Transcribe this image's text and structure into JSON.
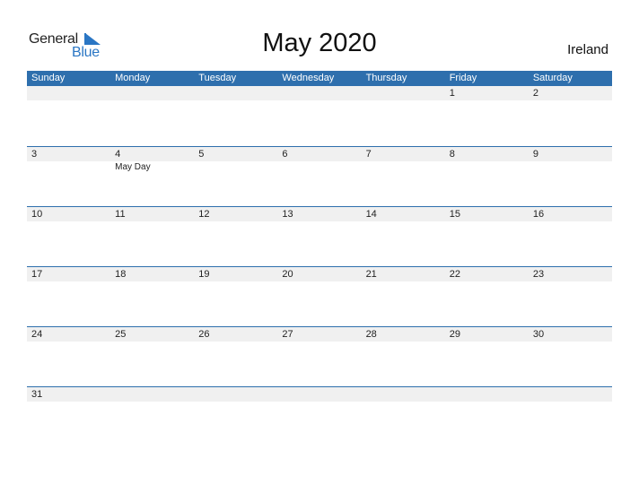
{
  "logo": {
    "text_general": "General",
    "text_blue": "Blue",
    "icon": "triangle-flag-icon",
    "brand_color": "#2a76c4"
  },
  "title": "May 2020",
  "country": "Ireland",
  "colors": {
    "header_bg": "#2e6fad",
    "date_strip_bg": "#f0f0f0"
  },
  "weekdays": [
    "Sunday",
    "Monday",
    "Tuesday",
    "Wednesday",
    "Thursday",
    "Friday",
    "Saturday"
  ],
  "weeks": [
    [
      {
        "day": "",
        "holiday": ""
      },
      {
        "day": "",
        "holiday": ""
      },
      {
        "day": "",
        "holiday": ""
      },
      {
        "day": "",
        "holiday": ""
      },
      {
        "day": "",
        "holiday": ""
      },
      {
        "day": "1",
        "holiday": ""
      },
      {
        "day": "2",
        "holiday": ""
      }
    ],
    [
      {
        "day": "3",
        "holiday": ""
      },
      {
        "day": "4",
        "holiday": "May Day"
      },
      {
        "day": "5",
        "holiday": ""
      },
      {
        "day": "6",
        "holiday": ""
      },
      {
        "day": "7",
        "holiday": ""
      },
      {
        "day": "8",
        "holiday": ""
      },
      {
        "day": "9",
        "holiday": ""
      }
    ],
    [
      {
        "day": "10",
        "holiday": ""
      },
      {
        "day": "11",
        "holiday": ""
      },
      {
        "day": "12",
        "holiday": ""
      },
      {
        "day": "13",
        "holiday": ""
      },
      {
        "day": "14",
        "holiday": ""
      },
      {
        "day": "15",
        "holiday": ""
      },
      {
        "day": "16",
        "holiday": ""
      }
    ],
    [
      {
        "day": "17",
        "holiday": ""
      },
      {
        "day": "18",
        "holiday": ""
      },
      {
        "day": "19",
        "holiday": ""
      },
      {
        "day": "20",
        "holiday": ""
      },
      {
        "day": "21",
        "holiday": ""
      },
      {
        "day": "22",
        "holiday": ""
      },
      {
        "day": "23",
        "holiday": ""
      }
    ],
    [
      {
        "day": "24",
        "holiday": ""
      },
      {
        "day": "25",
        "holiday": ""
      },
      {
        "day": "26",
        "holiday": ""
      },
      {
        "day": "27",
        "holiday": ""
      },
      {
        "day": "28",
        "holiday": ""
      },
      {
        "day": "29",
        "holiday": ""
      },
      {
        "day": "30",
        "holiday": ""
      }
    ],
    [
      {
        "day": "31",
        "holiday": ""
      },
      {
        "day": "",
        "holiday": ""
      },
      {
        "day": "",
        "holiday": ""
      },
      {
        "day": "",
        "holiday": ""
      },
      {
        "day": "",
        "holiday": ""
      },
      {
        "day": "",
        "holiday": ""
      },
      {
        "day": "",
        "holiday": ""
      }
    ]
  ]
}
